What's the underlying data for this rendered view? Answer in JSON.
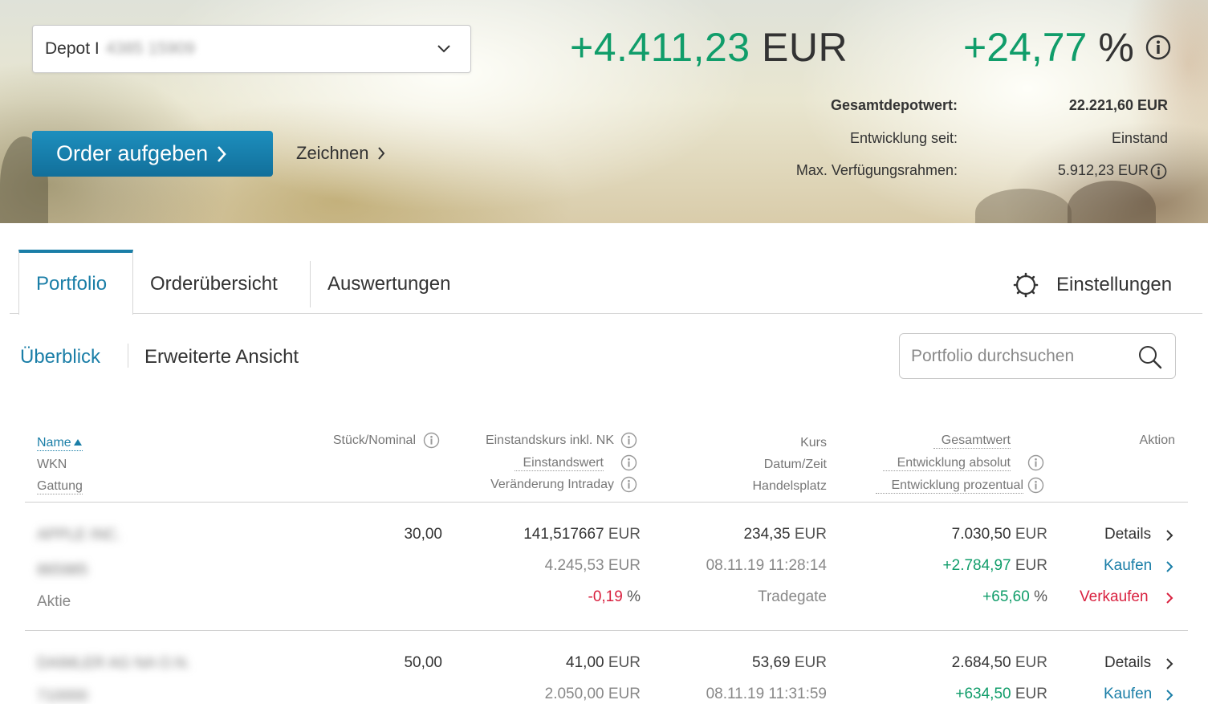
{
  "hero": {
    "depot_label": "Depot I",
    "depot_number": "4385 15909",
    "order_button": "Order aufgeben",
    "zeichnen": "Zeichnen",
    "performance_abs_value": "+4.411,23",
    "performance_abs_unit": "EUR",
    "performance_pct_value": "+24,77",
    "performance_pct_unit": "%",
    "summary": [
      {
        "label": "Gesamtdepotwert:",
        "value": "22.221,60 EUR"
      },
      {
        "label": "Entwicklung seit:",
        "value": "Einstand"
      },
      {
        "label": "Max. Verfügungsrahmen:",
        "value": "5.912,23 EUR"
      }
    ]
  },
  "tabs": {
    "portfolio": "Portfolio",
    "orders": "Orderübersicht",
    "reports": "Auswertungen",
    "settings": "Einstellungen"
  },
  "subnav": {
    "overview": "Überblick",
    "extended": "Erweiterte Ansicht",
    "search_placeholder": "Portfolio durchsuchen"
  },
  "table": {
    "headers": {
      "name": "Name",
      "wkn": "WKN",
      "type": "Gattung",
      "quantity": "Stück/Nominal",
      "cost_price": "Einstandskurs inkl. NK",
      "cost_value": "Einstandswert",
      "intraday": "Veränderung Intraday",
      "price": "Kurs",
      "datetime": "Datum/Zeit",
      "venue": "Handelsplatz",
      "total": "Gesamtwert",
      "dev_abs": "Entwicklung absolut",
      "dev_pct": "Entwicklung prozentual",
      "action": "Aktion"
    },
    "rows": [
      {
        "name": "APPLE INC.",
        "wkn": "865985",
        "type": "Aktie",
        "quantity": "30,00",
        "cost_price": "141,517667",
        "cost_value": "4.245,53",
        "intraday": "-0,19",
        "price": "234,35",
        "datetime": "08.11.19 11:28:14",
        "venue": "Tradegate",
        "total": "7.030,50",
        "dev_abs": "+2.784,97",
        "dev_pct": "+65,60",
        "details": "Details",
        "buy": "Kaufen",
        "sell": "Verkaufen"
      },
      {
        "name": "DAIMLER AG NA O.N.",
        "wkn": "710000",
        "type": "",
        "quantity": "50,00",
        "cost_price": "41,00",
        "cost_value": "2.050,00",
        "intraday": "",
        "price": "53,69",
        "datetime": "08.11.19 11:31:59",
        "venue": "",
        "total": "2.684,50",
        "dev_abs": "+634,50",
        "dev_pct": "",
        "details": "Details",
        "buy": "Kaufen",
        "sell": ""
      }
    ],
    "currency": "EUR",
    "percent": "%"
  },
  "colors": {
    "brand_blue": "#1a7ea7",
    "positive": "#109d6a",
    "negative": "#d9213f"
  },
  "icons": [
    "chevron-down-icon",
    "chevron-right-icon",
    "info-icon",
    "gear-icon",
    "search-icon",
    "sort-asc-icon"
  ]
}
